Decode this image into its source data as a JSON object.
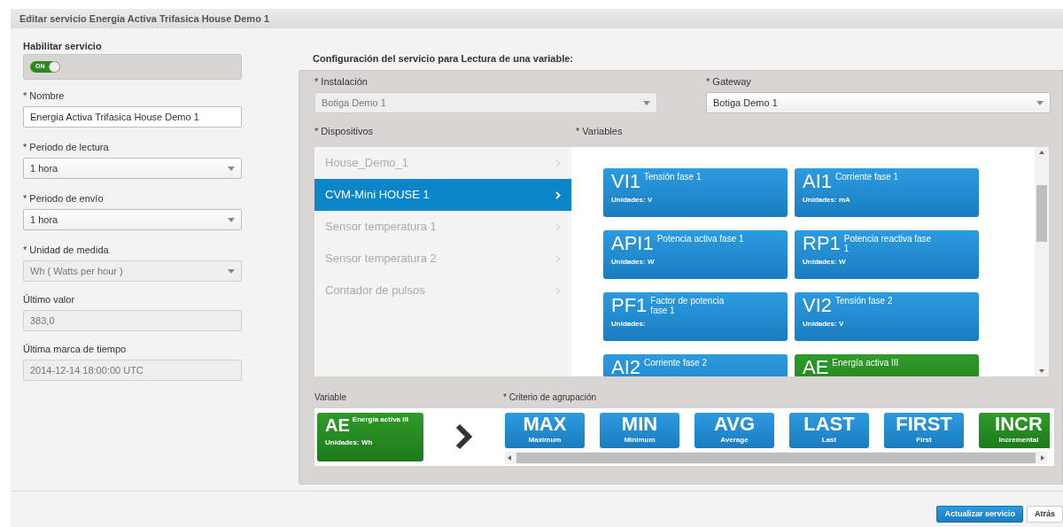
{
  "dialog": {
    "title": "Editar servicio Energia Activa Trifasica House Demo 1"
  },
  "left": {
    "enable_label": "Habilitar servicio",
    "toggle": {
      "on": true,
      "label": "ON"
    },
    "fields": [
      {
        "kind": "text",
        "label": "* Nombre",
        "value": "Energia Activa Trifasica House Demo 1",
        "disabled": false
      },
      {
        "kind": "select",
        "label": "* Periodo de lectura",
        "value": "1 hora",
        "disabled": false
      },
      {
        "kind": "select",
        "label": "* Periodo de envío",
        "value": "1 hora",
        "disabled": false
      },
      {
        "kind": "select",
        "label": "* Unidad de medida",
        "value": "Wh ( Watts per hour )",
        "disabled": true
      },
      {
        "kind": "text",
        "label": "Último valor",
        "value": "383,0",
        "disabled": true
      },
      {
        "kind": "text",
        "label": "Última marca de tiempo",
        "value": "2014-12-14 18:00:00 UTC",
        "disabled": true
      }
    ]
  },
  "config": {
    "title": "Configuración del servicio para Lectura de una variable:",
    "installation": {
      "label": "* Instalación",
      "value": "Botiga Demo 1",
      "disabled": true
    },
    "gateway": {
      "label": "* Gateway",
      "value": "Botiga Demo 1",
      "disabled": false
    },
    "devices_label": "* Dispositivos",
    "variables_label": "* Variables",
    "devices": [
      {
        "name": "House_Demo_1",
        "selected": false
      },
      {
        "name": "CVM-Mini HOUSE 1",
        "selected": true
      },
      {
        "name": "Sensor temperatura 1",
        "selected": false
      },
      {
        "name": "Sensor temperatura 2",
        "selected": false
      },
      {
        "name": "Contador de pulsos",
        "selected": false
      }
    ],
    "variables": [
      {
        "code": "VI1",
        "name": "Tensión fase 1",
        "units": "Unidades: V",
        "selected": false
      },
      {
        "code": "AI1",
        "name": "Corriente fase 1",
        "units": "Unidades: mA",
        "selected": false
      },
      {
        "code": "API1",
        "name": "Potencia activa fase 1",
        "units": "Unidades: W",
        "selected": false
      },
      {
        "code": "RP1",
        "name": "Potencia reactiva fase 1",
        "units": "Unidades: W",
        "selected": false
      },
      {
        "code": "PF1",
        "name": "Factor de potencia fase 1",
        "units": "Unidades:",
        "selected": false
      },
      {
        "code": "VI2",
        "name": "Tensión fase 2",
        "units": "Unidades: V",
        "selected": false
      },
      {
        "code": "AI2",
        "name": "Corriente fase 2",
        "selected": false
      },
      {
        "code": "AE",
        "name": "Energía activa III",
        "selected": true
      }
    ],
    "variable_label": "Variable",
    "criteria_label": "* Criterio de agrupación",
    "chosen_variable": {
      "code": "AE",
      "name": "Energía activa III",
      "units": "Unidades: Wh"
    },
    "criteria": [
      {
        "code": "MAX",
        "name": "Maximum",
        "selected": false
      },
      {
        "code": "MIN",
        "name": "Minimum",
        "selected": false
      },
      {
        "code": "AVG",
        "name": "Average",
        "selected": false
      },
      {
        "code": "LAST",
        "name": "Last",
        "selected": false
      },
      {
        "code": "FIRST",
        "name": "First",
        "selected": false
      },
      {
        "code": "INCR",
        "name": "Incremental",
        "selected": true
      }
    ]
  },
  "buttons": [
    {
      "label": "Actualizar servicio",
      "kind": "primary"
    },
    {
      "label": "Atrás",
      "kind": "default"
    }
  ]
}
